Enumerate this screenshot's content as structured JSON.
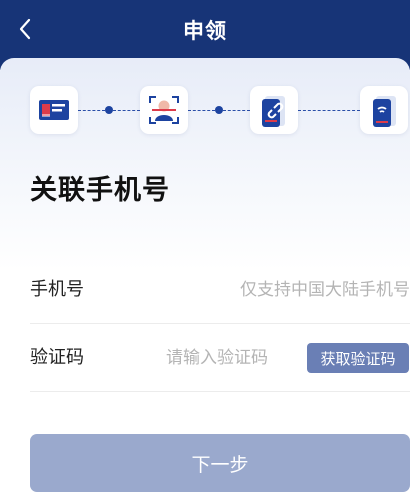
{
  "header": {
    "title": "申领",
    "back_icon": "chevron-left-icon",
    "background_color": "#173477"
  },
  "steps": [
    {
      "icon": "id-card-icon"
    },
    {
      "icon": "face-scan-icon"
    },
    {
      "icon": "link-phone-icon"
    },
    {
      "icon": "nfc-phone-icon"
    }
  ],
  "form": {
    "heading": "关联手机号",
    "phone": {
      "label": "手机号",
      "value": "",
      "placeholder": "仅支持中国大陆手机号"
    },
    "code": {
      "label": "验证码",
      "value": "",
      "placeholder": "请输入验证码",
      "button_label": "获取验证码"
    },
    "next_label": "下一步"
  },
  "colors": {
    "accent": "#1d43a0",
    "button_disabled": "#9aa9cd",
    "code_button": "#6a7fb5"
  }
}
